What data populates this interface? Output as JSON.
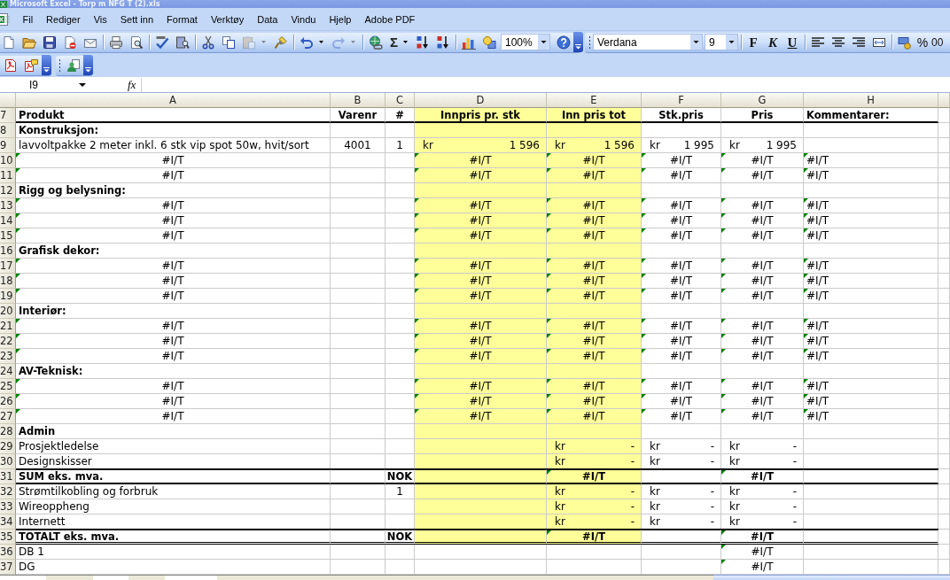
{
  "window": {
    "title": "Microsoft Excel - Torp m NFG T (2).xls"
  },
  "menu": [
    "Fil",
    "Rediger",
    "Vis",
    "Sett inn",
    "Format",
    "Verktøy",
    "Data",
    "Vindu",
    "Hjelp",
    "Adobe PDF"
  ],
  "standard_toolbar": {
    "paste": {
      "disabled": true
    },
    "redo": {
      "disabled": true
    },
    "autosum": "Σ",
    "zoom": "100%"
  },
  "formatting_toolbar": {
    "font": "Verdana",
    "size": "9",
    "bold": "F",
    "italic": "K",
    "underline": "U",
    "percent": "%",
    "comma": "00"
  },
  "formula_bar": {
    "name_box": "I9",
    "function_button": "fx"
  },
  "sheet": {
    "columns": [
      "A",
      "B",
      "C",
      "D",
      "E",
      "F",
      "G",
      "H"
    ],
    "rows": [
      {
        "number": "7",
        "kind": "header",
        "cells": [
          {
            "text": "Produkt",
            "kind": "text",
            "flagged": false,
            "shaded": false
          },
          {
            "text": "Varenr",
            "kind": "centered",
            "flagged": false,
            "shaded": false
          },
          {
            "text": "#",
            "kind": "centered",
            "flagged": false,
            "shaded": false
          },
          {
            "text": "Innpris pr. stk",
            "kind": "centered",
            "flagged": false,
            "shaded": true
          },
          {
            "text": "Inn pris tot",
            "kind": "centered",
            "flagged": false,
            "shaded": true
          },
          {
            "text": "Stk.pris",
            "kind": "centered",
            "flagged": false,
            "shaded": false
          },
          {
            "text": "Pris",
            "kind": "centered",
            "flagged": false,
            "shaded": false
          },
          {
            "text": "Kommentarer:",
            "kind": "text",
            "flagged": false,
            "shaded": false
          }
        ]
      },
      {
        "number": "8",
        "kind": "section",
        "cells": [
          {
            "text": "Konstruksjon:",
            "kind": "text",
            "flagged": false,
            "shaded": false
          },
          {
            "shaded": false
          },
          {
            "shaded": false
          },
          {
            "shaded": true
          },
          {
            "shaded": true
          },
          {
            "shaded": false
          },
          {
            "shaded": false
          },
          {
            "shaded": false
          }
        ]
      },
      {
        "number": "9",
        "kind": "item",
        "cells": [
          {
            "text": "lavvoltpakke 2 meter inkl. 6 stk vip spot 50w, hvit/sort",
            "kind": "text",
            "flagged": false,
            "shaded": false
          },
          {
            "text": "4001",
            "kind": "centered",
            "flagged": false,
            "shaded": false
          },
          {
            "text": "1",
            "kind": "centered",
            "flagged": false,
            "shaded": false
          },
          {
            "kind": "amount",
            "currency": "kr",
            "value": "1 596",
            "flagged": false,
            "shaded": true
          },
          {
            "kind": "amount",
            "currency": "kr",
            "value": "1 596",
            "flagged": false,
            "shaded": true
          },
          {
            "kind": "amount",
            "currency": "kr",
            "value": "1 995",
            "flagged": false,
            "shaded": false
          },
          {
            "kind": "amount",
            "currency": "kr",
            "value": "1 995",
            "flagged": false,
            "shaded": false
          },
          {
            "shaded": false
          }
        ]
      },
      {
        "number": "10",
        "kind": "item",
        "cells": [
          {
            "text": "#I/T",
            "kind": "centered",
            "flagged": true,
            "shaded": false
          },
          {
            "shaded": false
          },
          {
            "shaded": false
          },
          {
            "text": "#I/T",
            "kind": "centered",
            "flagged": true,
            "shaded": true
          },
          {
            "text": "#I/T",
            "kind": "centered",
            "flagged": true,
            "shaded": true
          },
          {
            "text": "#I/T",
            "kind": "centered",
            "flagged": true,
            "shaded": false
          },
          {
            "text": "#I/T",
            "kind": "centered",
            "flagged": true,
            "shaded": false
          },
          {
            "text": "#I/T",
            "kind": "text",
            "flagged": true,
            "shaded": false
          }
        ]
      },
      {
        "number": "11",
        "kind": "item",
        "cells": [
          {
            "text": "#I/T",
            "kind": "centered",
            "flagged": true,
            "shaded": false
          },
          {
            "shaded": false
          },
          {
            "shaded": false
          },
          {
            "text": "#I/T",
            "kind": "centered",
            "flagged": true,
            "shaded": true
          },
          {
            "text": "#I/T",
            "kind": "centered",
            "flagged": true,
            "shaded": true
          },
          {
            "text": "#I/T",
            "kind": "centered",
            "flagged": true,
            "shaded": false
          },
          {
            "text": "#I/T",
            "kind": "centered",
            "flagged": true,
            "shaded": false
          },
          {
            "text": "#I/T",
            "kind": "text",
            "flagged": true,
            "shaded": false
          }
        ]
      },
      {
        "number": "12",
        "kind": "section",
        "cells": [
          {
            "text": "Rigg og belysning:",
            "kind": "text",
            "flagged": false,
            "shaded": false
          },
          {
            "shaded": false
          },
          {
            "shaded": false
          },
          {
            "shaded": true
          },
          {
            "shaded": true
          },
          {
            "shaded": false
          },
          {
            "shaded": false
          },
          {
            "shaded": false
          }
        ]
      },
      {
        "number": "13",
        "kind": "item",
        "cells": [
          {
            "text": "#I/T",
            "kind": "centered",
            "flagged": true,
            "shaded": false
          },
          {
            "shaded": false
          },
          {
            "shaded": false
          },
          {
            "text": "#I/T",
            "kind": "centered",
            "flagged": true,
            "shaded": true
          },
          {
            "text": "#I/T",
            "kind": "centered",
            "flagged": true,
            "shaded": true
          },
          {
            "text": "#I/T",
            "kind": "centered",
            "flagged": true,
            "shaded": false
          },
          {
            "text": "#I/T",
            "kind": "centered",
            "flagged": true,
            "shaded": false
          },
          {
            "text": "#I/T",
            "kind": "text",
            "flagged": true,
            "shaded": false
          }
        ]
      },
      {
        "number": "14",
        "kind": "item",
        "cells": [
          {
            "text": "#I/T",
            "kind": "centered",
            "flagged": true,
            "shaded": false
          },
          {
            "shaded": false
          },
          {
            "shaded": false
          },
          {
            "text": "#I/T",
            "kind": "centered",
            "flagged": true,
            "shaded": true
          },
          {
            "text": "#I/T",
            "kind": "centered",
            "flagged": true,
            "shaded": true
          },
          {
            "text": "#I/T",
            "kind": "centered",
            "flagged": true,
            "shaded": false
          },
          {
            "text": "#I/T",
            "kind": "centered",
            "flagged": true,
            "shaded": false
          },
          {
            "text": "#I/T",
            "kind": "text",
            "flagged": true,
            "shaded": false
          }
        ]
      },
      {
        "number": "15",
        "kind": "item",
        "cells": [
          {
            "text": "#I/T",
            "kind": "centered",
            "flagged": true,
            "shaded": false
          },
          {
            "shaded": false
          },
          {
            "shaded": false
          },
          {
            "text": "#I/T",
            "kind": "centered",
            "flagged": true,
            "shaded": true
          },
          {
            "text": "#I/T",
            "kind": "centered",
            "flagged": true,
            "shaded": true
          },
          {
            "text": "#I/T",
            "kind": "centered",
            "flagged": true,
            "shaded": false
          },
          {
            "text": "#I/T",
            "kind": "centered",
            "flagged": true,
            "shaded": false
          },
          {
            "text": "#I/T",
            "kind": "text",
            "flagged": true,
            "shaded": false
          }
        ]
      },
      {
        "number": "16",
        "kind": "section",
        "cells": [
          {
            "text": "Grafisk dekor:",
            "kind": "text",
            "flagged": false,
            "shaded": false
          },
          {
            "shaded": false
          },
          {
            "shaded": false
          },
          {
            "shaded": true
          },
          {
            "shaded": true
          },
          {
            "shaded": false
          },
          {
            "shaded": false
          },
          {
            "shaded": false
          }
        ]
      },
      {
        "number": "17",
        "kind": "item",
        "cells": [
          {
            "text": "#I/T",
            "kind": "centered",
            "flagged": true,
            "shaded": false
          },
          {
            "shaded": false
          },
          {
            "shaded": false
          },
          {
            "text": "#I/T",
            "kind": "centered",
            "flagged": true,
            "shaded": true
          },
          {
            "text": "#I/T",
            "kind": "centered",
            "flagged": true,
            "shaded": true
          },
          {
            "text": "#I/T",
            "kind": "centered",
            "flagged": true,
            "shaded": false
          },
          {
            "text": "#I/T",
            "kind": "centered",
            "flagged": true,
            "shaded": false
          },
          {
            "text": "#I/T",
            "kind": "text",
            "flagged": true,
            "shaded": false
          }
        ]
      },
      {
        "number": "18",
        "kind": "item",
        "cells": [
          {
            "text": "#I/T",
            "kind": "centered",
            "flagged": true,
            "shaded": false
          },
          {
            "shaded": false
          },
          {
            "shaded": false
          },
          {
            "text": "#I/T",
            "kind": "centered",
            "flagged": true,
            "shaded": true
          },
          {
            "text": "#I/T",
            "kind": "centered",
            "flagged": true,
            "shaded": true
          },
          {
            "text": "#I/T",
            "kind": "centered",
            "flagged": true,
            "shaded": false
          },
          {
            "text": "#I/T",
            "kind": "centered",
            "flagged": true,
            "shaded": false
          },
          {
            "text": "#I/T",
            "kind": "text",
            "flagged": true,
            "shaded": false
          }
        ]
      },
      {
        "number": "19",
        "kind": "item",
        "cells": [
          {
            "text": "#I/T",
            "kind": "centered",
            "flagged": true,
            "shaded": false
          },
          {
            "shaded": false
          },
          {
            "shaded": false
          },
          {
            "text": "#I/T",
            "kind": "centered",
            "flagged": true,
            "shaded": true
          },
          {
            "text": "#I/T",
            "kind": "centered",
            "flagged": true,
            "shaded": true
          },
          {
            "text": "#I/T",
            "kind": "centered",
            "flagged": true,
            "shaded": false
          },
          {
            "text": "#I/T",
            "kind": "centered",
            "flagged": true,
            "shaded": false
          },
          {
            "text": "#I/T",
            "kind": "text",
            "flagged": true,
            "shaded": false
          }
        ]
      },
      {
        "number": "20",
        "kind": "section",
        "cells": [
          {
            "text": "Interiør:",
            "kind": "text",
            "flagged": false,
            "shaded": false
          },
          {
            "shaded": false
          },
          {
            "shaded": false
          },
          {
            "shaded": true
          },
          {
            "shaded": true
          },
          {
            "shaded": false
          },
          {
            "shaded": false
          },
          {
            "shaded": false
          }
        ]
      },
      {
        "number": "21",
        "kind": "item",
        "cells": [
          {
            "text": "#I/T",
            "kind": "centered",
            "flagged": true,
            "shaded": false
          },
          {
            "shaded": false
          },
          {
            "shaded": false
          },
          {
            "text": "#I/T",
            "kind": "centered",
            "flagged": true,
            "shaded": true
          },
          {
            "text": "#I/T",
            "kind": "centered",
            "flagged": true,
            "shaded": true
          },
          {
            "text": "#I/T",
            "kind": "centered",
            "flagged": true,
            "shaded": false
          },
          {
            "text": "#I/T",
            "kind": "centered",
            "flagged": true,
            "shaded": false
          },
          {
            "text": "#I/T",
            "kind": "text",
            "flagged": true,
            "shaded": false
          }
        ]
      },
      {
        "number": "22",
        "kind": "item",
        "cells": [
          {
            "text": "#I/T",
            "kind": "centered",
            "flagged": true,
            "shaded": false
          },
          {
            "shaded": false
          },
          {
            "shaded": false
          },
          {
            "text": "#I/T",
            "kind": "centered",
            "flagged": true,
            "shaded": true
          },
          {
            "text": "#I/T",
            "kind": "centered",
            "flagged": true,
            "shaded": true
          },
          {
            "text": "#I/T",
            "kind": "centered",
            "flagged": true,
            "shaded": false
          },
          {
            "text": "#I/T",
            "kind": "centered",
            "flagged": true,
            "shaded": false
          },
          {
            "text": "#I/T",
            "kind": "text",
            "flagged": true,
            "shaded": false
          }
        ]
      },
      {
        "number": "23",
        "kind": "item",
        "cells": [
          {
            "text": "#I/T",
            "kind": "centered",
            "flagged": true,
            "shaded": false
          },
          {
            "shaded": false
          },
          {
            "shaded": false
          },
          {
            "text": "#I/T",
            "kind": "centered",
            "flagged": true,
            "shaded": true
          },
          {
            "text": "#I/T",
            "kind": "centered",
            "flagged": true,
            "shaded": true
          },
          {
            "text": "#I/T",
            "kind": "centered",
            "flagged": true,
            "shaded": false
          },
          {
            "text": "#I/T",
            "kind": "centered",
            "flagged": true,
            "shaded": false
          },
          {
            "text": "#I/T",
            "kind": "text",
            "flagged": true,
            "shaded": false
          }
        ]
      },
      {
        "number": "24",
        "kind": "section",
        "cells": [
          {
            "text": "AV-Teknisk:",
            "kind": "text",
            "flagged": false,
            "shaded": false
          },
          {
            "shaded": false
          },
          {
            "shaded": false
          },
          {
            "shaded": true
          },
          {
            "shaded": true
          },
          {
            "shaded": false
          },
          {
            "shaded": false
          },
          {
            "shaded": false
          }
        ]
      },
      {
        "number": "25",
        "kind": "item",
        "cells": [
          {
            "text": "#I/T",
            "kind": "centered",
            "flagged": true,
            "shaded": false
          },
          {
            "shaded": false
          },
          {
            "shaded": false
          },
          {
            "text": "#I/T",
            "kind": "centered",
            "flagged": true,
            "shaded": true
          },
          {
            "text": "#I/T",
            "kind": "centered",
            "flagged": true,
            "shaded": true
          },
          {
            "text": "#I/T",
            "kind": "centered",
            "flagged": true,
            "shaded": false
          },
          {
            "text": "#I/T",
            "kind": "centered",
            "flagged": true,
            "shaded": false
          },
          {
            "text": "#I/T",
            "kind": "text",
            "flagged": true,
            "shaded": false
          }
        ]
      },
      {
        "number": "26",
        "kind": "item",
        "cells": [
          {
            "text": "#I/T",
            "kind": "centered",
            "flagged": true,
            "shaded": false
          },
          {
            "shaded": false
          },
          {
            "shaded": false
          },
          {
            "text": "#I/T",
            "kind": "centered",
            "flagged": true,
            "shaded": true
          },
          {
            "text": "#I/T",
            "kind": "centered",
            "flagged": true,
            "shaded": true
          },
          {
            "text": "#I/T",
            "kind": "centered",
            "flagged": true,
            "shaded": false
          },
          {
            "text": "#I/T",
            "kind": "centered",
            "flagged": true,
            "shaded": false
          },
          {
            "text": "#I/T",
            "kind": "text",
            "flagged": true,
            "shaded": false
          }
        ]
      },
      {
        "number": "27",
        "kind": "item",
        "cells": [
          {
            "text": "#I/T",
            "kind": "centered",
            "flagged": true,
            "shaded": false
          },
          {
            "shaded": false
          },
          {
            "shaded": false
          },
          {
            "text": "#I/T",
            "kind": "centered",
            "flagged": true,
            "shaded": true
          },
          {
            "text": "#I/T",
            "kind": "centered",
            "flagged": true,
            "shaded": true
          },
          {
            "text": "#I/T",
            "kind": "centered",
            "flagged": true,
            "shaded": false
          },
          {
            "text": "#I/T",
            "kind": "centered",
            "flagged": true,
            "shaded": false
          },
          {
            "text": "#I/T",
            "kind": "text",
            "flagged": true,
            "shaded": false
          }
        ]
      },
      {
        "number": "28",
        "kind": "section",
        "cells": [
          {
            "text": "Admin",
            "kind": "text",
            "flagged": false,
            "shaded": false
          },
          {
            "shaded": false
          },
          {
            "shaded": false
          },
          {
            "shaded": true
          },
          {
            "shaded": true
          },
          {
            "shaded": false
          },
          {
            "shaded": false
          },
          {
            "shaded": false
          }
        ]
      },
      {
        "number": "29",
        "kind": "item",
        "cells": [
          {
            "text": "Prosjektledelse",
            "kind": "text",
            "flagged": false,
            "shaded": false
          },
          {
            "shaded": false
          },
          {
            "shaded": false
          },
          {
            "shaded": true
          },
          {
            "kind": "amount",
            "currency": "kr",
            "value": "-",
            "flagged": false,
            "shaded": true
          },
          {
            "kind": "amount",
            "currency": "kr",
            "value": "-",
            "flagged": false,
            "shaded": false
          },
          {
            "kind": "amount",
            "currency": "kr",
            "value": "-",
            "flagged": false,
            "shaded": false
          },
          {
            "shaded": false
          }
        ]
      },
      {
        "number": "30",
        "kind": "item",
        "cells": [
          {
            "text": "Designskisser",
            "kind": "text",
            "flagged": false,
            "shaded": false
          },
          {
            "shaded": false
          },
          {
            "shaded": false
          },
          {
            "shaded": true
          },
          {
            "kind": "amount",
            "currency": "kr",
            "value": "-",
            "flagged": false,
            "shaded": true
          },
          {
            "kind": "amount",
            "currency": "kr",
            "value": "-",
            "flagged": false,
            "shaded": false
          },
          {
            "kind": "amount",
            "currency": "kr",
            "value": "-",
            "flagged": false,
            "shaded": false
          },
          {
            "shaded": false
          }
        ]
      },
      {
        "number": "31",
        "kind": "total",
        "cells": [
          {
            "text": "SUM eks. mva.",
            "kind": "text",
            "flagged": false,
            "shaded": false
          },
          {
            "shaded": false
          },
          {
            "text": "NOK",
            "kind": "centered",
            "flagged": false,
            "shaded": false
          },
          {
            "shaded": true
          },
          {
            "text": "#I/T",
            "kind": "centered",
            "flagged": true,
            "shaded": true
          },
          {
            "shaded": false
          },
          {
            "text": "#I/T",
            "kind": "centered",
            "flagged": true,
            "shaded": false
          },
          {
            "shaded": false
          }
        ]
      },
      {
        "number": "32",
        "kind": "item",
        "cells": [
          {
            "text": "Strømtilkobling og forbruk",
            "kind": "text",
            "flagged": false,
            "shaded": false
          },
          {
            "shaded": false
          },
          {
            "text": "1",
            "kind": "centered",
            "flagged": false,
            "shaded": false
          },
          {
            "shaded": true
          },
          {
            "kind": "amount",
            "currency": "kr",
            "value": "-",
            "flagged": false,
            "shaded": true
          },
          {
            "kind": "amount",
            "currency": "kr",
            "value": "-",
            "flagged": false,
            "shaded": false
          },
          {
            "kind": "amount",
            "currency": "kr",
            "value": "-",
            "flagged": false,
            "shaded": false
          },
          {
            "shaded": false
          }
        ]
      },
      {
        "number": "33",
        "kind": "item",
        "cells": [
          {
            "text": "Wireoppheng",
            "kind": "text",
            "flagged": false,
            "shaded": false
          },
          {
            "shaded": false
          },
          {
            "shaded": false
          },
          {
            "shaded": true
          },
          {
            "kind": "amount",
            "currency": "kr",
            "value": "-",
            "flagged": false,
            "shaded": true
          },
          {
            "kind": "amount",
            "currency": "kr",
            "value": "-",
            "flagged": false,
            "shaded": false
          },
          {
            "kind": "amount",
            "currency": "kr",
            "value": "-",
            "flagged": false,
            "shaded": false
          },
          {
            "shaded": false
          }
        ]
      },
      {
        "number": "34",
        "kind": "item",
        "cells": [
          {
            "text": "Internett",
            "kind": "text",
            "flagged": false,
            "shaded": false
          },
          {
            "shaded": false
          },
          {
            "shaded": false
          },
          {
            "shaded": true
          },
          {
            "kind": "amount",
            "currency": "kr",
            "value": "-",
            "flagged": false,
            "shaded": true
          },
          {
            "kind": "amount",
            "currency": "kr",
            "value": "-",
            "flagged": false,
            "shaded": false
          },
          {
            "kind": "amount",
            "currency": "kr",
            "value": "-",
            "flagged": false,
            "shaded": false
          },
          {
            "shaded": false
          }
        ]
      },
      {
        "number": "35",
        "kind": "grand-total",
        "cells": [
          {
            "text": "TOTALT eks. mva.",
            "kind": "text",
            "flagged": false,
            "shaded": false
          },
          {
            "shaded": false
          },
          {
            "text": "NOK",
            "kind": "centered",
            "flagged": false,
            "shaded": false
          },
          {
            "shaded": true
          },
          {
            "text": "#I/T",
            "kind": "centered",
            "flagged": true,
            "shaded": true
          },
          {
            "shaded": false
          },
          {
            "text": "#I/T",
            "kind": "centered",
            "flagged": true,
            "shaded": false
          },
          {
            "shaded": false
          }
        ]
      },
      {
        "number": "36",
        "kind": "item",
        "cells": [
          {
            "text": "DB 1",
            "kind": "text",
            "flagged": false,
            "shaded": false
          },
          {
            "shaded": false
          },
          {
            "shaded": false
          },
          {
            "shaded": false
          },
          {
            "shaded": false
          },
          {
            "shaded": false
          },
          {
            "text": "#I/T",
            "kind": "centered",
            "flagged": true,
            "shaded": false
          },
          {
            "shaded": false
          }
        ]
      },
      {
        "number": "37",
        "kind": "item",
        "cells": [
          {
            "text": "DG",
            "kind": "text",
            "flagged": false,
            "shaded": false
          },
          {
            "shaded": false
          },
          {
            "shaded": false
          },
          {
            "shaded": false
          },
          {
            "shaded": false
          },
          {
            "shaded": false
          },
          {
            "text": "#I/T",
            "kind": "centered",
            "flagged": true,
            "shaded": false
          },
          {
            "shaded": false
          }
        ]
      }
    ]
  }
}
